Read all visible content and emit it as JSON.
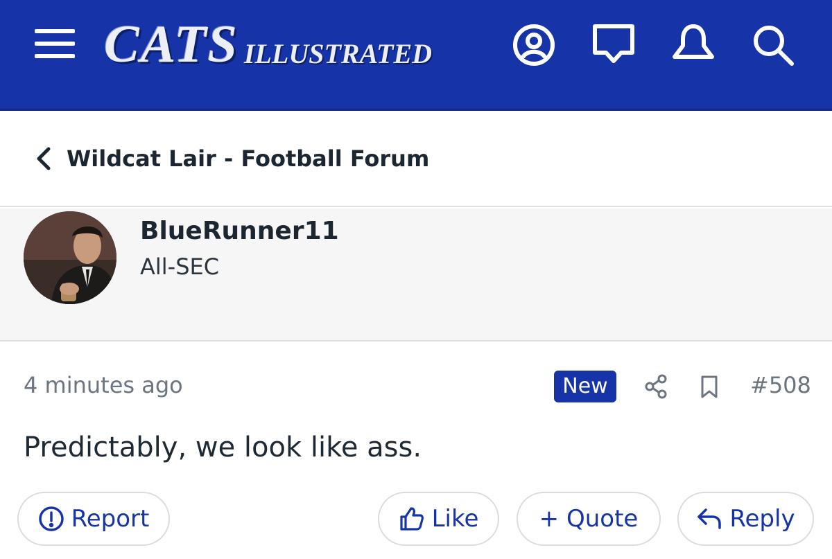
{
  "header": {
    "logo_main": "CATS",
    "logo_sub": "ILLUSTRATED",
    "bg_color": "#1634a8",
    "icons": [
      "menu-icon",
      "account-icon",
      "messages-icon",
      "notifications-icon",
      "search-icon"
    ]
  },
  "breadcrumb": {
    "back_icon": "chevron-left-icon",
    "title": "Wildcat Lair - Football Forum"
  },
  "post": {
    "author": {
      "name": "BlueRunner11",
      "title": "All-SEC"
    },
    "timestamp": "4 minutes ago",
    "badge": "New",
    "number": "#508",
    "body": "Predictably, we look like ass.",
    "meta_icons": [
      "share-icon",
      "bookmark-icon"
    ]
  },
  "actions": {
    "report": "Report",
    "like": "Like",
    "quote": "+ Quote",
    "reply": "Reply"
  },
  "colors": {
    "accent": "#1634a8",
    "muted_text": "#6b7480",
    "card_bg": "#f6f6f6"
  }
}
